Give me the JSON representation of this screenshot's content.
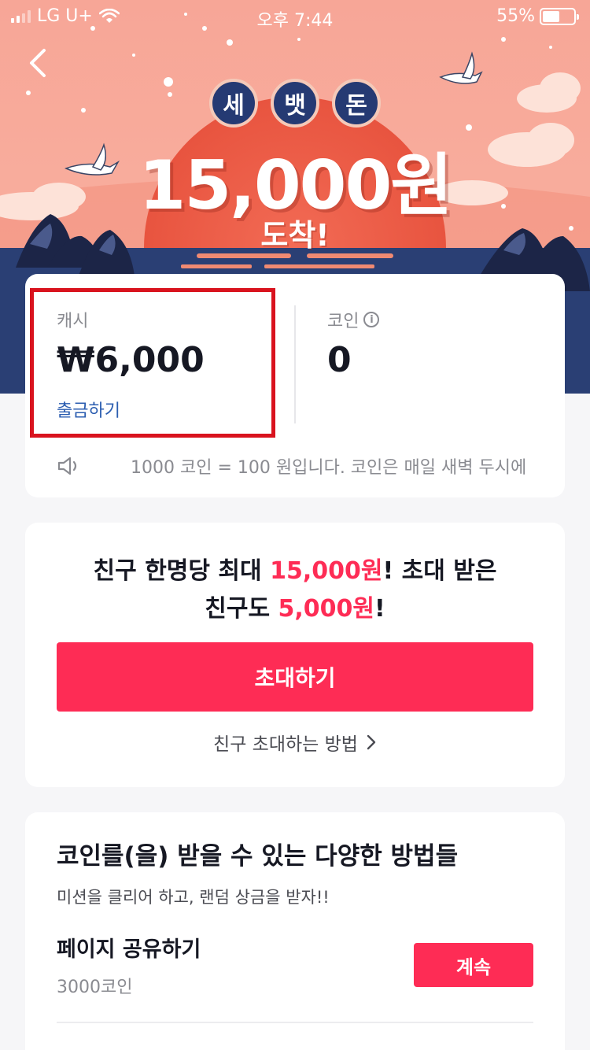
{
  "status_bar": {
    "carrier": "LG U+",
    "time": "오후 7:44",
    "battery_percent": "55%",
    "battery_level": 0.55
  },
  "banner": {
    "badges": [
      "세",
      "뱃",
      "돈"
    ],
    "amount": "15,000원",
    "subtitle": "도착!"
  },
  "balance": {
    "cash_label": "캐시",
    "cash_value": "₩6,000",
    "withdraw_label": "출금하기",
    "coin_label": "코인",
    "coin_value": "0",
    "notice": "1000 코인 = 100 원입니다. 코인은 매일 새벽 두시에"
  },
  "invite": {
    "line1_prefix": "친구 한명당 최대 ",
    "line1_highlight": "15,000원",
    "line1_suffix": "! 초대 받은",
    "line2_prefix": "친구도 ",
    "line2_highlight": "5,000원",
    "line2_suffix": "!",
    "button_label": "초대하기",
    "howto_label": "친구 초대하는 방법"
  },
  "earn": {
    "title": "코인를(을) 받을 수 있는 다양한 방법들",
    "subtitle": "미션을 클리어 하고, 랜덤 상금을 받자!!",
    "tasks": [
      {
        "name": "페이지 공유하기",
        "reward": "3000코인",
        "button": "계속"
      }
    ]
  },
  "colors": {
    "accent": "#fe2c55",
    "highlight_box": "#d9131e",
    "banner_sky": "#f8a698",
    "banner_sea": "#2a3f74"
  }
}
